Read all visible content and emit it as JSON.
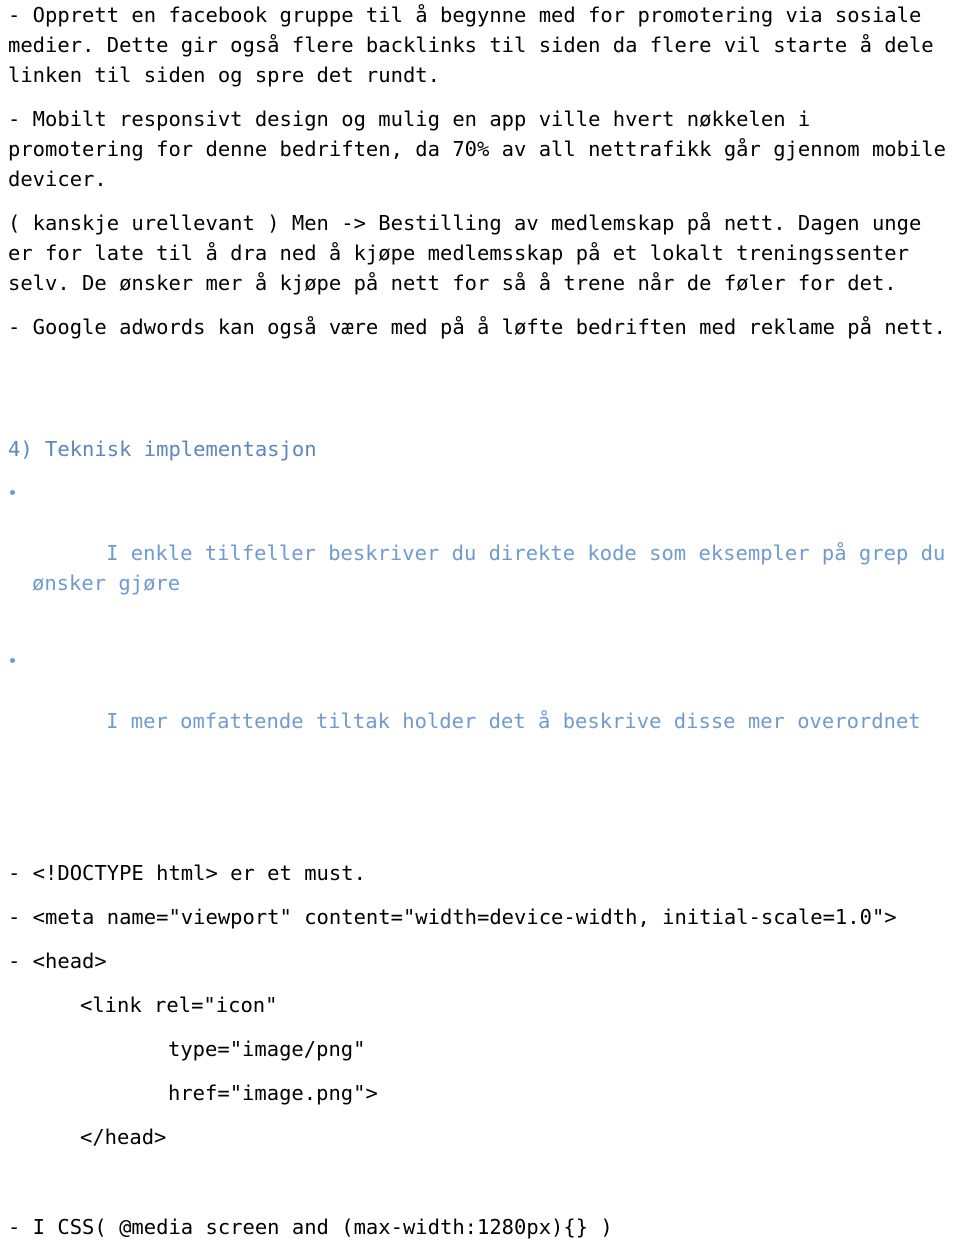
{
  "document": {
    "paragraphs": [
      "- Opprett en facebook gruppe til å begynne med for promotering via sosiale medier. Dette gir også flere backlinks til siden da flere vil starte å dele linken til siden og spre det rundt.",
      "- Mobilt responsivt design og mulig en app ville hvert nøkkelen i promotering for denne bedriften, da 70% av all nettrafikk går gjennom mobile devicer.",
      "( kanskje urellevant ) Men -> Bestilling av medlemskap på nett. Dagen unge er for late til å dra ned å kjøpe medlemsskap på et lokalt treningssenter selv. De ønsker mer å kjøpe på nett for så å trene når de føler for det.",
      "- Google adwords kan også være med på å løfte bedriften med reklame på nett."
    ],
    "section_heading": "4) Teknisk implementasjon",
    "bullets": [
      "I enkle tilfeller beskriver du direkte kode som eksempler på grep du ønsker gjøre",
      "I mer omfattende tiltak holder det å beskrive disse mer overordnet"
    ],
    "code_lines": [
      {
        "text": "- <!DOCTYPE html> er et must.",
        "indent": 0
      },
      {
        "text": "- <meta name=\"viewport\" content=\"width=device-width, initial-scale=1.0\">",
        "indent": 0
      },
      {
        "text": "- <head>",
        "indent": 0
      },
      {
        "text": "<link rel=\"icon\"",
        "indent": 1
      },
      {
        "text": "type=\"image/png\"",
        "indent": 2
      },
      {
        "text": "href=\"image.png\">",
        "indent": 2
      },
      {
        "text": "</head>",
        "indent": 1
      },
      {
        "text": "- I CSS( @media screen and (max-width:1280px){} )",
        "indent": 0
      }
    ]
  },
  "colors": {
    "heading": "#5b86bf",
    "bullet": "#6f9bd1",
    "body": "#000000",
    "background": "#ffffff"
  }
}
